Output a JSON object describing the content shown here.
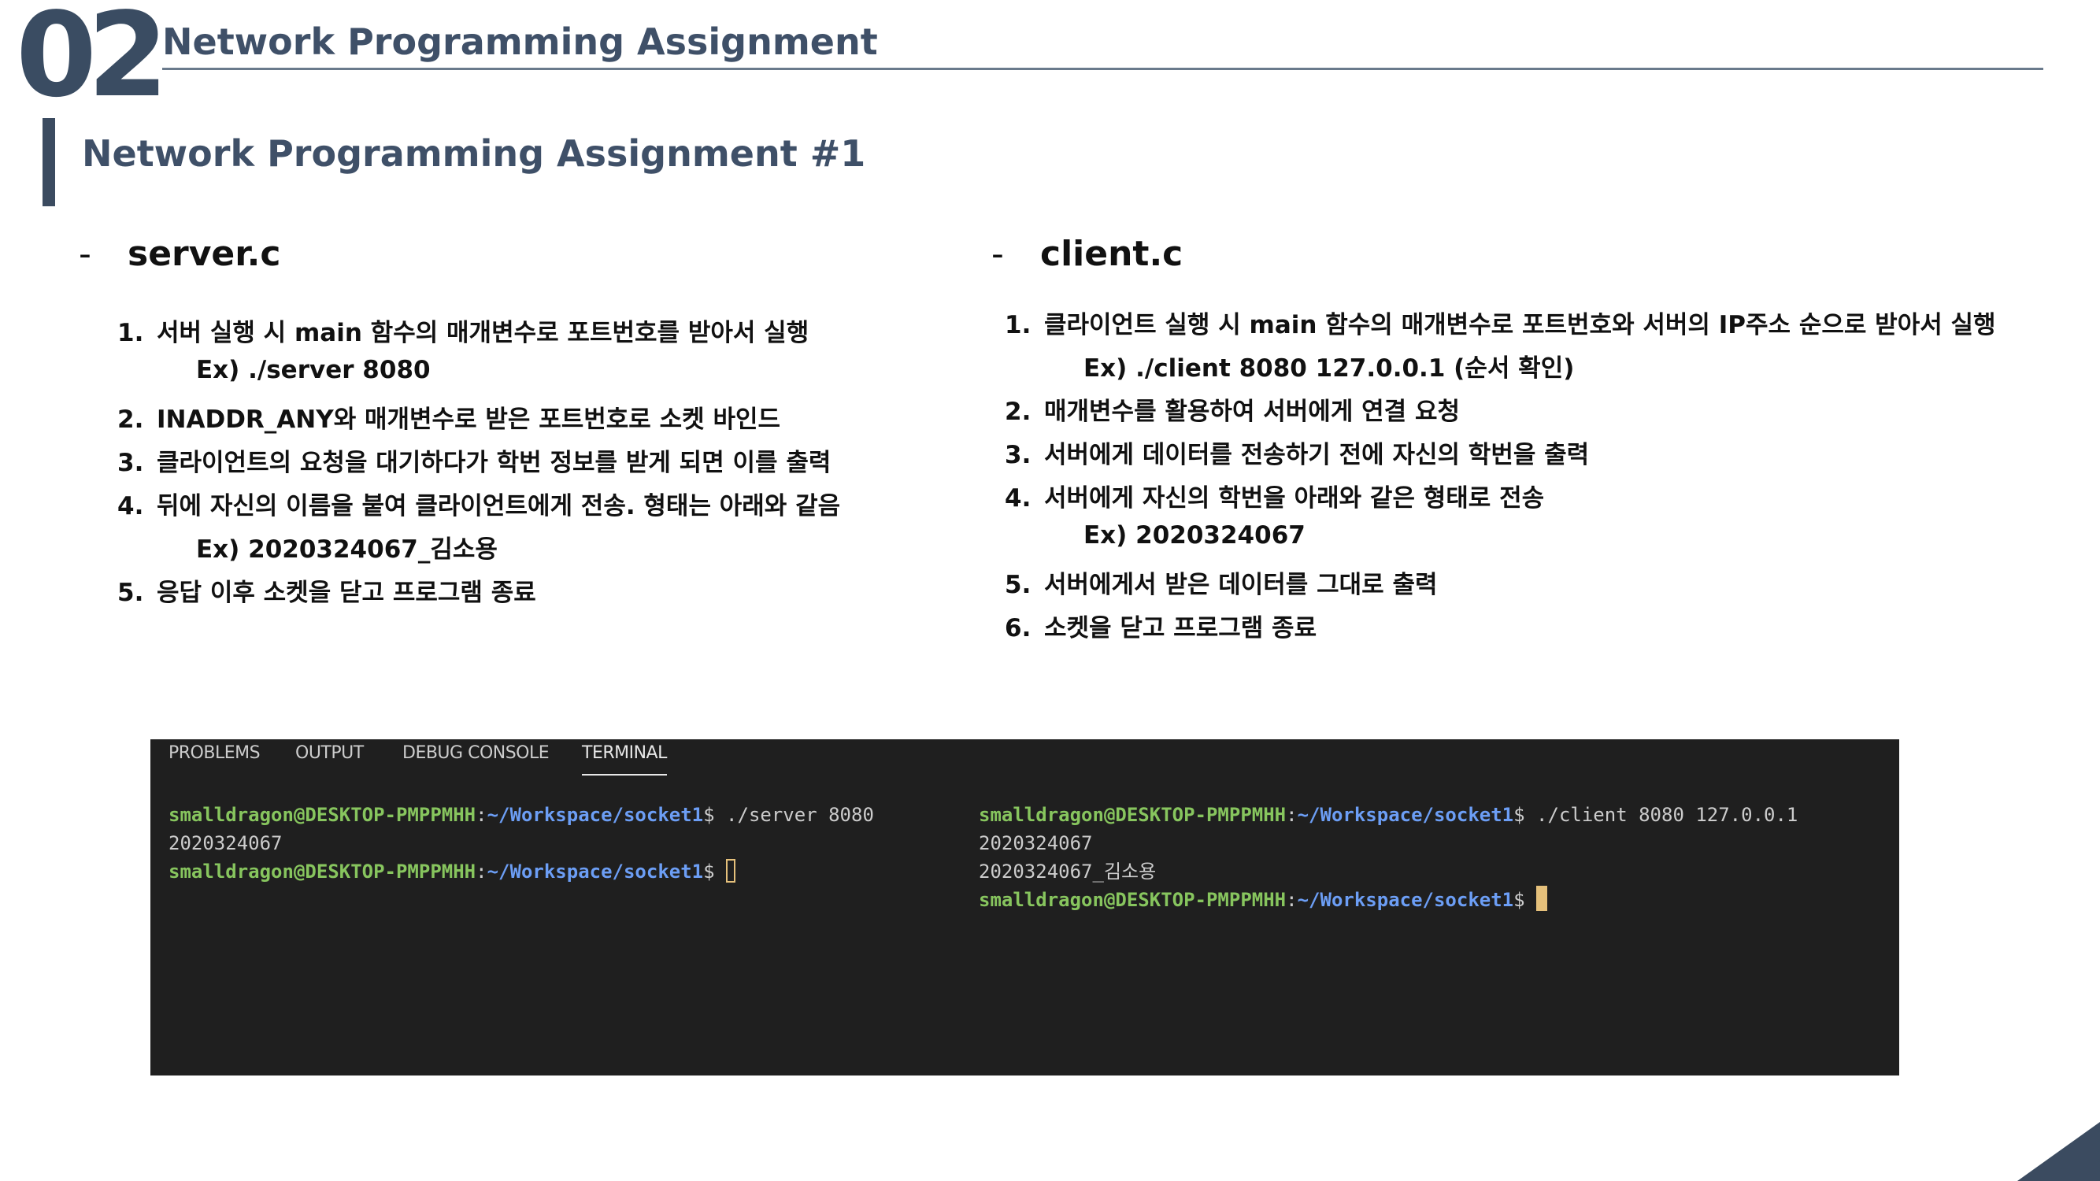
{
  "header": {
    "section_number": "02",
    "title": "Network Programming Assignment"
  },
  "subtitle": "Network Programming Assignment #1",
  "server": {
    "dash": "-",
    "heading": "server.c",
    "items": [
      {
        "num": "1.",
        "text": "서버 실행 시 main 함수의 매개변수로 포트번호를 받아서 실행",
        "sub": "Ex) ./server 8080"
      },
      {
        "num": "2.",
        "text": "INADDR_ANY와 매개변수로 받은 포트번호로 소켓 바인드"
      },
      {
        "num": "3.",
        "text": "클라이언트의 요청을 대기하다가 학번 정보를 받게 되면 이를 출력"
      },
      {
        "num": "4.",
        "text": "뒤에 자신의 이름을 붙여 클라이언트에게 전송. 형태는 아래와 같음",
        "sub": "Ex) 2020324067_김소용"
      },
      {
        "num": "5.",
        "text": "응답 이후 소켓을 닫고 프로그램 종료"
      }
    ]
  },
  "client": {
    "dash": "-",
    "heading": "client.c",
    "items": [
      {
        "num": "1.",
        "text": "클라이언트 실행 시 main 함수의 매개변수로 포트번호와 서버의 IP주소 순으로 받아서 실행",
        "sub": "Ex) ./client 8080 127.0.0.1 (순서 확인)"
      },
      {
        "num": "2.",
        "text": "매개변수를 활용하여 서버에게 연결 요청"
      },
      {
        "num": "3.",
        "text": "서버에게 데이터를 전송하기 전에 자신의 학번을 출력"
      },
      {
        "num": "4.",
        "text": "서버에게 자신의 학번을 아래와 같은 형태로 전송",
        "sub": "Ex) 2020324067"
      },
      {
        "num": "5.",
        "text": "서버에게서 받은 데이터를 그대로 출력"
      },
      {
        "num": "6.",
        "text": "소켓을 닫고 프로그램 종료"
      }
    ]
  },
  "terminal": {
    "tabs": [
      "PROBLEMS",
      "OUTPUT",
      "DEBUG CONSOLE",
      "TERMINAL"
    ],
    "active_tab": "TERMINAL",
    "user_host": "smalldragon@DESKTOP-PMPPMHH",
    "colon": ":",
    "path": "~/Workspace/socket1",
    "prompt": "$ ",
    "left": {
      "command": "./server 8080",
      "output": "2020324067"
    },
    "right": {
      "command": "./client 8080 127.0.0.1",
      "output1": "2020324067",
      "output2": "2020324067_김소용"
    }
  },
  "colors": {
    "accent": "#3b4b60",
    "terminal_bg": "#1f1f1f",
    "user_green": "#87c55e",
    "path_blue": "#6c9ef5",
    "cursor_yellow": "#e5c07b"
  }
}
